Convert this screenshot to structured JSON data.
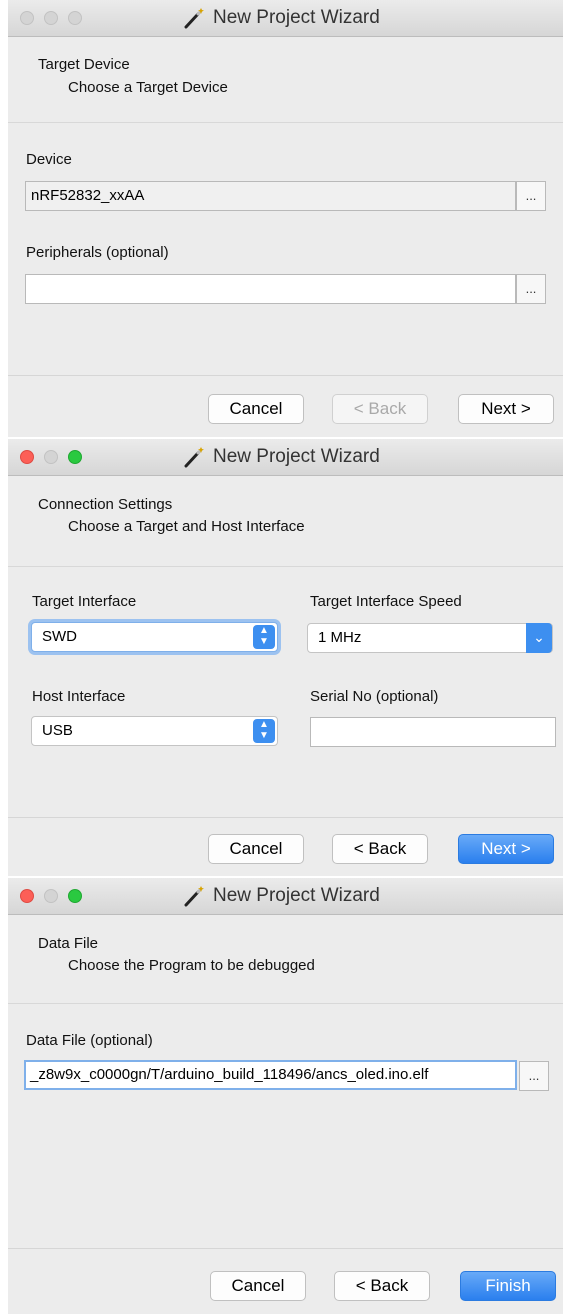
{
  "windows": [
    {
      "title": "New Project Wizard",
      "traffic_lights_active": false,
      "header_title": "Target Device",
      "header_subtitle": "Choose a Target Device",
      "device_label": "Device",
      "device_value": "nRF52832_xxAA",
      "peripherals_label": "Peripherals (optional)",
      "peripherals_value": "",
      "browse_label": "...",
      "cancel_label": "Cancel",
      "back_label": "< Back",
      "next_label": "Next >"
    },
    {
      "title": "New Project Wizard",
      "traffic_lights_active": true,
      "header_title": "Connection Settings",
      "header_subtitle": "Choose a Target and Host Interface",
      "target_interface_label": "Target Interface",
      "target_interface_value": "SWD",
      "target_speed_label": "Target Interface Speed",
      "target_speed_value": "1 MHz",
      "host_interface_label": "Host Interface",
      "host_interface_value": "USB",
      "serial_label": "Serial No (optional)",
      "serial_value": "",
      "cancel_label": "Cancel",
      "back_label": "< Back",
      "next_label": "Next >"
    },
    {
      "title": "New Project Wizard",
      "traffic_lights_active": true,
      "header_title": "Data File",
      "header_subtitle": "Choose the Program to be debugged",
      "data_file_label": "Data File (optional)",
      "data_file_value": "_z8w9x_c0000gn/T/arduino_build_118496/ancs_oled.ino.elf",
      "browse_label": "...",
      "cancel_label": "Cancel",
      "back_label": "< Back",
      "finish_label": "Finish"
    }
  ],
  "colors": {
    "window_bg": "#ececec",
    "accent_blue": "#3d8ff0",
    "close_red": "#fc5f57",
    "zoom_green": "#2ac940"
  },
  "icons": {
    "title_icon": "magic-wand-icon",
    "stepper_icon": "up-down-stepper-icon",
    "dropdown_icon": "chevron-down-icon"
  }
}
